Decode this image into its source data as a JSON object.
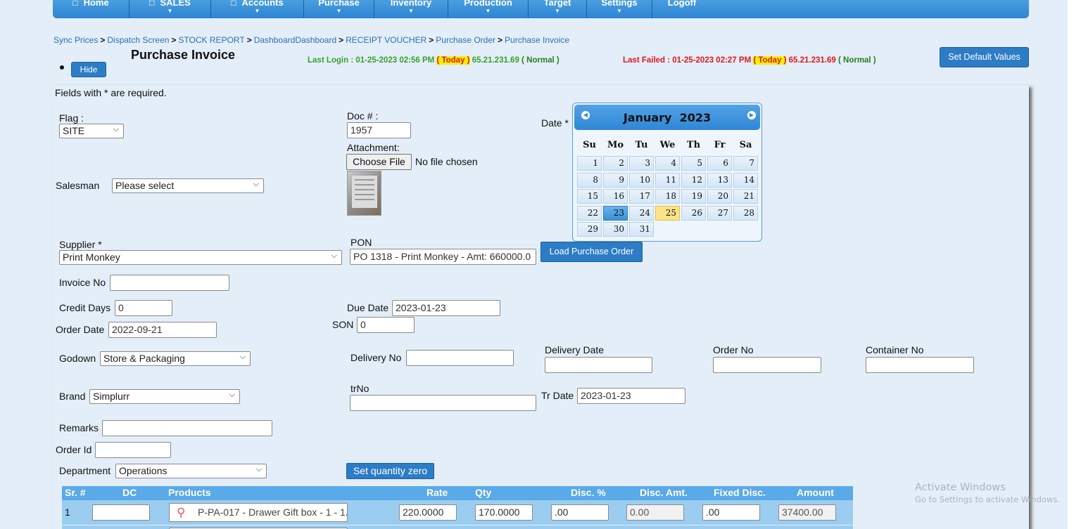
{
  "nav": {
    "items": [
      {
        "label": "Home",
        "box": true,
        "caret": false
      },
      {
        "label": "SALES",
        "box": true,
        "caret": true
      },
      {
        "label": "Accounts",
        "box": true,
        "caret": true
      },
      {
        "label": "Purchase",
        "box": false,
        "caret": true
      },
      {
        "label": "Inventory",
        "box": false,
        "caret": true
      },
      {
        "label": "Production",
        "box": false,
        "caret": true
      },
      {
        "label": "Target",
        "box": false,
        "caret": true
      },
      {
        "label": "Settings",
        "box": false,
        "caret": true
      },
      {
        "label": "Logoff",
        "box": false,
        "caret": false
      }
    ]
  },
  "breadcrumb": [
    "Sync Prices",
    "Dispatch Screen",
    "STOCK REPORT",
    "DashboardDashboard",
    "RECEIPT VOUCHER",
    "Purchase Order",
    "Purchase Invoice"
  ],
  "header": {
    "title": "Purchase Invoice",
    "hide_label": "Hide",
    "set_default_label": "Set Default Values"
  },
  "login": {
    "last_login_prefix": "Last Login : 01-25-2023 02:56 PM ",
    "last_login_today": "( Today )",
    "last_login_ip": " 65.21.231.69 ",
    "last_login_status": "( Normal )",
    "last_failed_prefix": "Last Failed : 01-25-2023 02:27 PM ",
    "last_failed_today": "( Today )",
    "last_failed_ip": " 65.21.231.69 ",
    "last_failed_status": "( Normal )"
  },
  "form": {
    "required_note": "Fields with * are required.",
    "flag_label": "Flag :",
    "flag_value": "SITE",
    "doc_label": "Doc # :",
    "doc_value": "1957",
    "attachment_label": "Attachment:",
    "choose_file_label": "Choose File",
    "no_file_label": "No file chosen",
    "date_label": "Date *",
    "salesman_label": "Salesman",
    "salesman_value": "Please select",
    "supplier_label": "Supplier *",
    "supplier_value": "Print Monkey",
    "pon_label": "PON",
    "pon_value": "PO 1318 - Print Monkey - Amt: 660000.0",
    "load_po_label": "Load Purchase Order",
    "invoice_no_label": "Invoice No",
    "invoice_no_value": "",
    "credit_days_label": "Credit Days",
    "credit_days_value": "0",
    "due_date_label": "Due Date",
    "due_date_value": "2023-01-23",
    "order_date_label": "Order Date",
    "order_date_value": "2022-09-21",
    "son_label": "SON",
    "son_value": "0",
    "godown_label": "Godown",
    "godown_value": "Store & Packaging",
    "delivery_no_label": "Delivery No",
    "delivery_date_label": "Delivery Date",
    "order_no_label": "Order No",
    "container_no_label": "Container No",
    "brand_label": "Brand",
    "brand_value": "Simplurr",
    "trno_label": "trNo",
    "tr_date_label": "Tr Date",
    "tr_date_value": "2023-01-23",
    "remarks_label": "Remarks",
    "order_id_label": "Order Id",
    "department_label": "Department",
    "department_value": "Operations",
    "set_qty_zero_label": "Set quantity zero"
  },
  "calendar": {
    "month": "January",
    "year": "2023",
    "weekdays": [
      "Su",
      "Mo",
      "Tu",
      "We",
      "Th",
      "Fr",
      "Sa"
    ],
    "weeks": [
      [
        "1",
        "2",
        "3",
        "4",
        "5",
        "6",
        "7"
      ],
      [
        "8",
        "9",
        "10",
        "11",
        "12",
        "13",
        "14"
      ],
      [
        "15",
        "16",
        "17",
        "18",
        "19",
        "20",
        "21"
      ],
      [
        "22",
        "23",
        "24",
        "25",
        "26",
        "27",
        "28"
      ],
      [
        "29",
        "30",
        "31",
        "",
        "",
        "",
        ""
      ]
    ],
    "selected": "23",
    "today": "25"
  },
  "table": {
    "headers": [
      "Sr. #",
      "DC",
      "Products",
      "Rate",
      "Qty",
      "Disc. %",
      "Disc. Amt.",
      "Fixed Disc.",
      "Amount"
    ],
    "row": {
      "sr": "1",
      "dc": "",
      "product": "P-PA-017 - Drawer Gift box - 1 - 1...",
      "rate": "220.0000",
      "qty": "170.0000",
      "disc_pct": ".00",
      "disc_amt": "0.00",
      "fixed_disc": ".00",
      "amount": "37400.00"
    }
  },
  "watermark": {
    "line1": "Activate Windows",
    "line2": "Go to Settings to activate Windows."
  },
  "colors": {
    "accent": "#2d7cc6",
    "login_green": "#39a12e",
    "failed_red": "#e3161c",
    "today_highlight": "#f8f000"
  }
}
